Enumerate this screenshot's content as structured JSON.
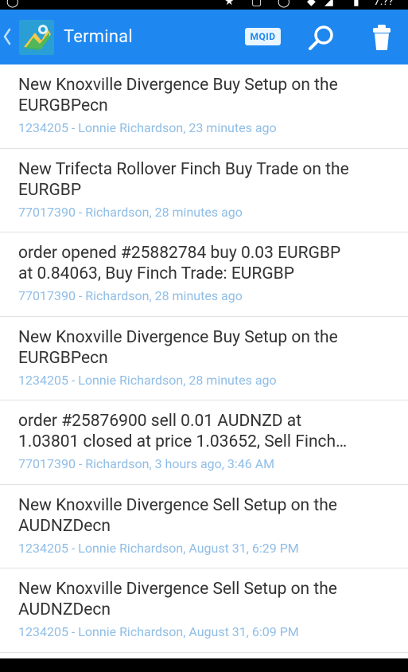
{
  "status_bar": {
    "left_glyph": "◯",
    "right_glyphs": [
      "★",
      "▢",
      "◯",
      "◆",
      "◢",
      "▮",
      "7:??"
    ]
  },
  "app_bar": {
    "title": "Terminal",
    "mqid_label": "MQID",
    "colors": {
      "bar": "#1e88f0",
      "meta_text": "#8fbde6"
    },
    "icons": [
      "back-chevron-icon",
      "app-logo-icon",
      "search-icon",
      "trash-icon"
    ]
  },
  "messages": [
    {
      "title_line1": "New Knoxville Divergence Buy Setup on the",
      "title_line2": "EURGBPecn",
      "meta": "1234205 - Lonnie Richardson, 23 minutes ago"
    },
    {
      "title_line1": "New Trifecta Rollover Finch Buy Trade on the",
      "title_line2": "EURGBP",
      "meta": "77017390 - Richardson, 28 minutes ago"
    },
    {
      "title_line1": "order opened #25882784 buy 0.03 EURGBP",
      "title_line2": "at 0.84063, Buy Finch Trade: EURGBP",
      "meta": "77017390 - Richardson, 28 minutes ago"
    },
    {
      "title_line1": "New Knoxville Divergence Buy Setup on the",
      "title_line2": "EURGBPecn",
      "meta": "1234205 - Lonnie Richardson, 28 minutes ago"
    },
    {
      "title_line1": "order #25876900 sell 0.01 AUDNZD at",
      "title_line2": "1.03801 closed at price 1.03652, Sell Finch…",
      "meta": "77017390 - Richardson, 3 hours ago, 3:46 AM"
    },
    {
      "title_line1": "New Knoxville Divergence Sell Setup on the",
      "title_line2": "AUDNZDecn",
      "meta": "1234205 - Lonnie Richardson, August 31, 6:29 PM"
    },
    {
      "title_line1": "New Knoxville Divergence Sell Setup on the",
      "title_line2": "AUDNZDecn",
      "meta": "1234205 - Lonnie Richardson, August 31, 6:09 PM"
    }
  ]
}
